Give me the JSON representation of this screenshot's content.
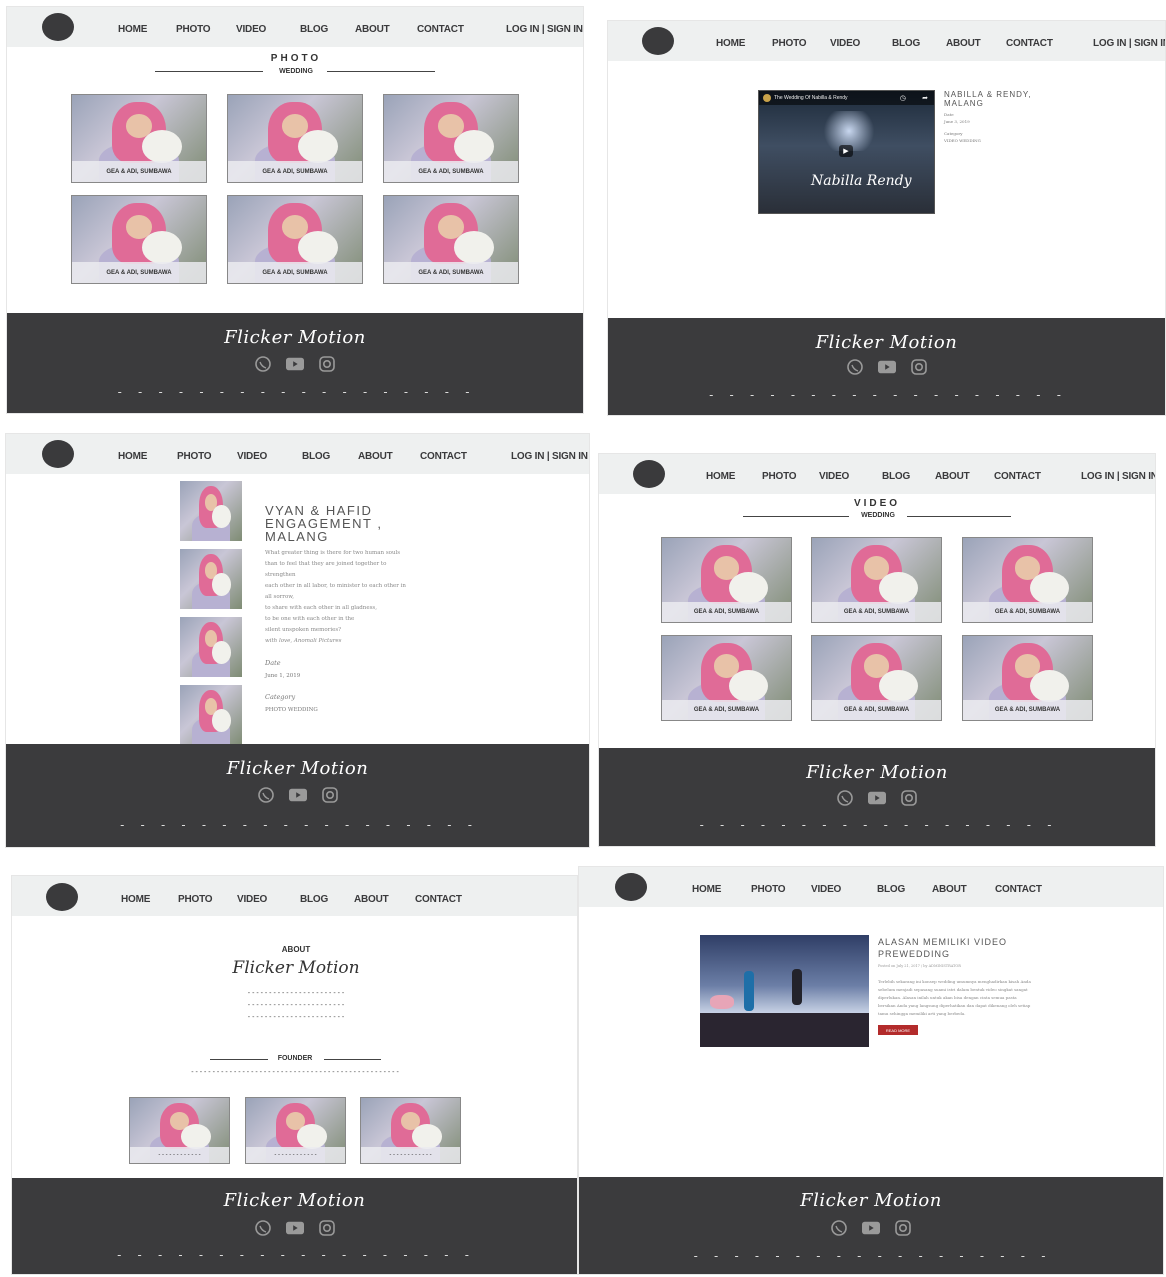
{
  "nav": {
    "home": "HOME",
    "photo": "PHOTO",
    "video": "VIDEO",
    "blog": "BLOG",
    "about": "ABOUT",
    "contact": "CONTACT",
    "login": "LOG IN | SIGN IN"
  },
  "footer": {
    "brand": "Flicker Motion",
    "dashes": "- - - - - - - - - - - - - - - - - -"
  },
  "thumb_caption": "GEA & ADI, SUMBAWA",
  "photo_page": {
    "title": "PHOTO",
    "subtitle": "WEDDING"
  },
  "video_page": {
    "title": "VIDEO",
    "subtitle": "WEDDING"
  },
  "video_detail": {
    "title": "NABILLA & RENDY, MALANG",
    "player_title": "The Wedding Of Nabilla & Rendy",
    "player_script": "Nabilla Rendy",
    "date_label": "Date",
    "date": "June 3, 2019",
    "category_label": "Category",
    "category": "VIDEO WEDDING"
  },
  "photo_detail": {
    "title": "VYAN & HAFID ENGAGEMENT , MALANG",
    "body": [
      "What greater thing is there for two human souls",
      "than to feel that they are joined together to",
      "strengthen",
      "each other in all labor, to minister to each other in",
      "all sorrow,",
      "to share with each other in all gladness,",
      "to be one with each other in the",
      "silent unspoken memories?",
      "with love, Anomali Pictures"
    ],
    "date_label": "Date",
    "date": "June 1, 2019",
    "category_label": "Category",
    "category": "PHOTO WEDDING"
  },
  "about_page": {
    "label": "ABOUT",
    "brand": "Flicker Motion",
    "founder": "FOUNDER",
    "dashes": "- - - - - - - - - - - - - - - - - - - - - - -",
    "long_dashes": "- - - - - - - - - - - - - - - - - - - - - - - - - - - - - - - - - - - - - - - - - - - - - - - - -",
    "thumb_dashes": "- - - - - - - - - - - -"
  },
  "blog_page": {
    "title": "ALASAN MEMILIKI VIDEO PREWEDDING",
    "meta": "Posted on July 21, 2017 / by ADMINISTRATOR",
    "excerpt": [
      "Terlebih sekarang ini konsep wedding umumnya menghadirkan kisah Anda",
      "sebelum menjadi sepasang suami istri dalam bentuk video singkat sangat",
      "diperlukan. Alasan inilah untuk akan bisa dengan cinta semua pasta",
      "bersikan Anda yang langsung diperhatikan dan dapat dikenang oleh setiap",
      "tamu sehingga memiliki arti yang berbeda."
    ],
    "read_more": "READ MORE"
  },
  "colors": {
    "nav_bg": "#eef0f0",
    "footer_bg": "#3b3b3d",
    "logo": "#3a3a3c",
    "accent_red": "#b32b2b"
  }
}
